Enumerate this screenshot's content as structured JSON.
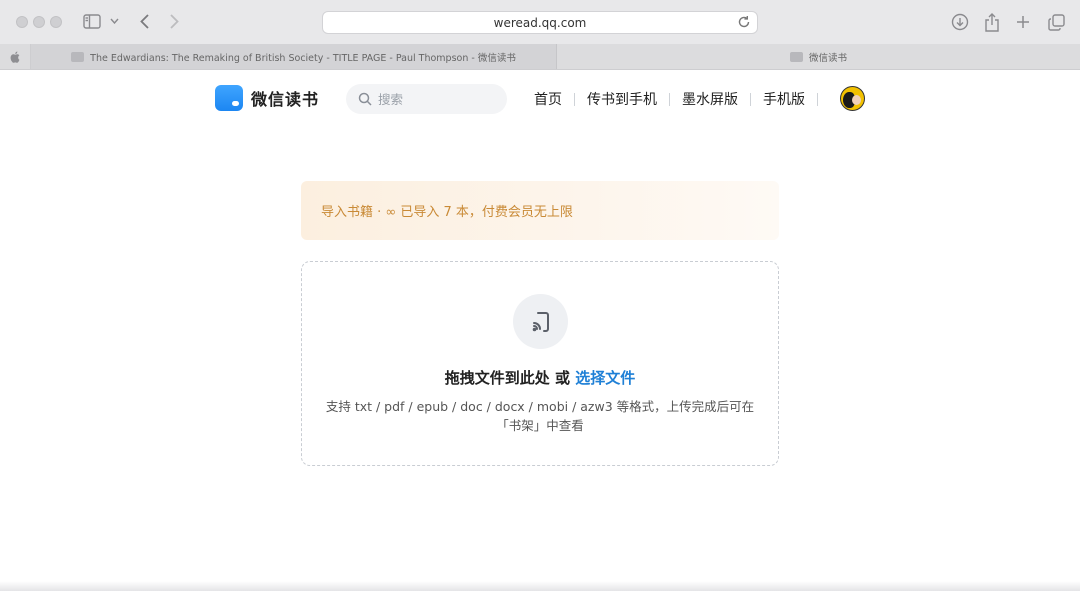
{
  "browser": {
    "url": "weread.qq.com",
    "tabs": [
      {
        "title": "The Edwardians: The Remaking of British Society - TITLE PAGE - Paul Thompson - 微信读书",
        "active": true
      },
      {
        "title": "微信读书",
        "active": false
      }
    ]
  },
  "header": {
    "logo_text": "微信读书",
    "search_placeholder": "搜索",
    "nav": [
      {
        "label": "首页"
      },
      {
        "label": "传书到手机"
      },
      {
        "label": "墨水屏版"
      },
      {
        "label": "手机版"
      }
    ]
  },
  "notice": {
    "text": "导入书籍 · ∞ 已导入 7 本，付费会员无上限"
  },
  "dropzone": {
    "title": "拖拽文件到此处",
    "connector": " 或 ",
    "choose_label": "选择文件",
    "description": "支持 txt / pdf / epub / doc / docx / mobi / azw3 等格式，上传完成后可在「书架」中查看"
  },
  "colors": {
    "brand_blue": "#1f80d6",
    "notice_text": "#c98a36",
    "notice_bg": "#fcefdf"
  },
  "icons": {
    "search": "search-icon",
    "upload": "cast-icon",
    "reload": "reload-icon"
  }
}
